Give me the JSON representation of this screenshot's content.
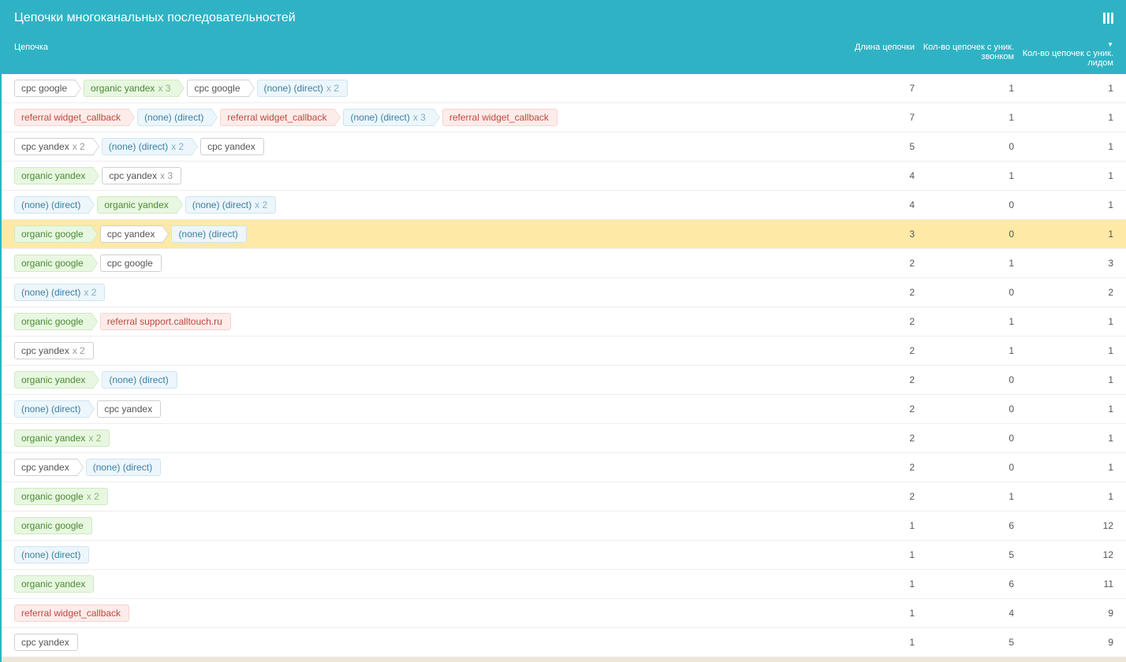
{
  "header": {
    "title": "Цепочки многоканальных последовательностей"
  },
  "columns": {
    "chain": "Цепочка",
    "length": "Длина цепочки",
    "calls": "Кол-во цепочек с уник. звонком",
    "leads": "Кол-во цепочек с уник. лидом"
  },
  "rows": [
    {
      "tags": [
        {
          "label": "cpc google",
          "type": "white"
        },
        {
          "label": "organic yandex",
          "type": "green",
          "mult": "x 3"
        },
        {
          "label": "cpc google",
          "type": "white"
        },
        {
          "label": "(none) (direct)",
          "type": "blue",
          "mult": "x 2"
        }
      ],
      "len": 7,
      "calls": 1,
      "leads": 1
    },
    {
      "tags": [
        {
          "label": "referral widget_callback",
          "type": "red"
        },
        {
          "label": "(none) (direct)",
          "type": "blue"
        },
        {
          "label": "referral widget_callback",
          "type": "red"
        },
        {
          "label": "(none) (direct)",
          "type": "blue",
          "mult": "x 3"
        },
        {
          "label": "referral widget_callback",
          "type": "red"
        }
      ],
      "len": 7,
      "calls": 1,
      "leads": 1
    },
    {
      "tags": [
        {
          "label": "cpc yandex",
          "type": "white",
          "mult": "x 2"
        },
        {
          "label": "(none) (direct)",
          "type": "blue",
          "mult": "x 2"
        },
        {
          "label": "cpc yandex",
          "type": "white"
        }
      ],
      "len": 5,
      "calls": 0,
      "leads": 1
    },
    {
      "tags": [
        {
          "label": "organic yandex",
          "type": "green"
        },
        {
          "label": "cpc yandex",
          "type": "white",
          "mult": "x 3"
        }
      ],
      "len": 4,
      "calls": 1,
      "leads": 1
    },
    {
      "tags": [
        {
          "label": "(none) (direct)",
          "type": "blue"
        },
        {
          "label": "organic yandex",
          "type": "green"
        },
        {
          "label": "(none) (direct)",
          "type": "blue",
          "mult": "x 2"
        }
      ],
      "len": 4,
      "calls": 0,
      "leads": 1
    },
    {
      "highlight": true,
      "tags": [
        {
          "label": "organic google",
          "type": "green"
        },
        {
          "label": "cpc yandex",
          "type": "white"
        },
        {
          "label": "(none) (direct)",
          "type": "blue"
        }
      ],
      "len": 3,
      "calls": 0,
      "leads": 1
    },
    {
      "tags": [
        {
          "label": "organic google",
          "type": "green"
        },
        {
          "label": "cpc google",
          "type": "white"
        }
      ],
      "len": 2,
      "calls": 1,
      "leads": 3
    },
    {
      "tags": [
        {
          "label": "(none) (direct)",
          "type": "blue",
          "mult": "x 2"
        }
      ],
      "len": 2,
      "calls": 0,
      "leads": 2
    },
    {
      "tags": [
        {
          "label": "organic google",
          "type": "green"
        },
        {
          "label": "referral support.calltouch.ru",
          "type": "red"
        }
      ],
      "len": 2,
      "calls": 1,
      "leads": 1
    },
    {
      "tags": [
        {
          "label": "cpc yandex",
          "type": "white",
          "mult": "x 2"
        }
      ],
      "len": 2,
      "calls": 1,
      "leads": 1
    },
    {
      "tags": [
        {
          "label": "organic yandex",
          "type": "green"
        },
        {
          "label": "(none) (direct)",
          "type": "blue"
        }
      ],
      "len": 2,
      "calls": 0,
      "leads": 1
    },
    {
      "tags": [
        {
          "label": "(none) (direct)",
          "type": "blue"
        },
        {
          "label": "cpc yandex",
          "type": "white"
        }
      ],
      "len": 2,
      "calls": 0,
      "leads": 1
    },
    {
      "tags": [
        {
          "label": "organic yandex",
          "type": "green",
          "mult": "x 2"
        }
      ],
      "len": 2,
      "calls": 0,
      "leads": 1
    },
    {
      "tags": [
        {
          "label": "cpc yandex",
          "type": "white"
        },
        {
          "label": "(none) (direct)",
          "type": "blue"
        }
      ],
      "len": 2,
      "calls": 0,
      "leads": 1
    },
    {
      "tags": [
        {
          "label": "organic google",
          "type": "green",
          "mult": "x 2"
        }
      ],
      "len": 2,
      "calls": 1,
      "leads": 1
    },
    {
      "tags": [
        {
          "label": "organic google",
          "type": "green"
        }
      ],
      "len": 1,
      "calls": 6,
      "leads": 12
    },
    {
      "tags": [
        {
          "label": "(none) (direct)",
          "type": "blue"
        }
      ],
      "len": 1,
      "calls": 5,
      "leads": 12
    },
    {
      "tags": [
        {
          "label": "organic yandex",
          "type": "green"
        }
      ],
      "len": 1,
      "calls": 6,
      "leads": 11
    },
    {
      "tags": [
        {
          "label": "referral widget_callback",
          "type": "red"
        }
      ],
      "len": 1,
      "calls": 4,
      "leads": 9
    },
    {
      "tags": [
        {
          "label": "cpc yandex",
          "type": "white"
        }
      ],
      "len": 1,
      "calls": 5,
      "leads": 9
    }
  ]
}
